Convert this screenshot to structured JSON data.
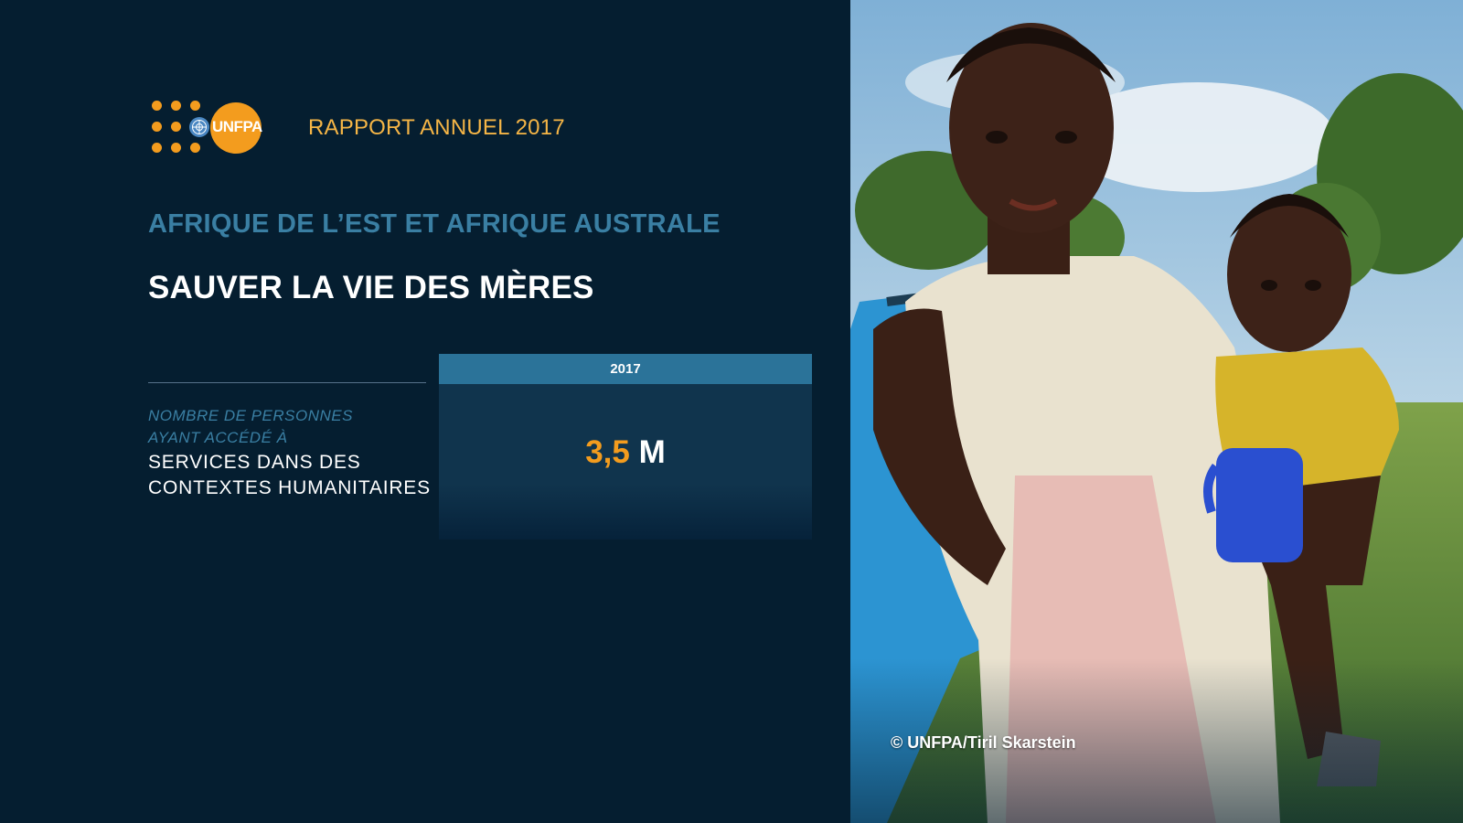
{
  "header": {
    "logo_text": "UNFPA",
    "report_title": "RAPPORT ANNUEL 2017"
  },
  "region": "AFRIQUE DE L’EST ET AFRIQUE AUSTRALE",
  "title": "SAUVER LA VIE DES MÈRES",
  "metric": {
    "label_prefix_line1": "NOMBRE DE PERSONNES",
    "label_prefix_line2": "AYANT ACCÉDÉ À",
    "label_main_line1": "SERVICES DANS DES",
    "label_main_line2": "CONTEXTES HUMANITAIRES",
    "year": "2017",
    "value": "3,5",
    "unit": "M"
  },
  "photo": {
    "credit": "© UNFPA/Tiril Skarstein"
  },
  "colors": {
    "background": "#051e30",
    "accent_orange": "#f39c1e",
    "report_title": "#f5b546",
    "region_blue": "#3a7fa3",
    "stat_header": "#2b7399",
    "stat_box": "#10344d"
  }
}
